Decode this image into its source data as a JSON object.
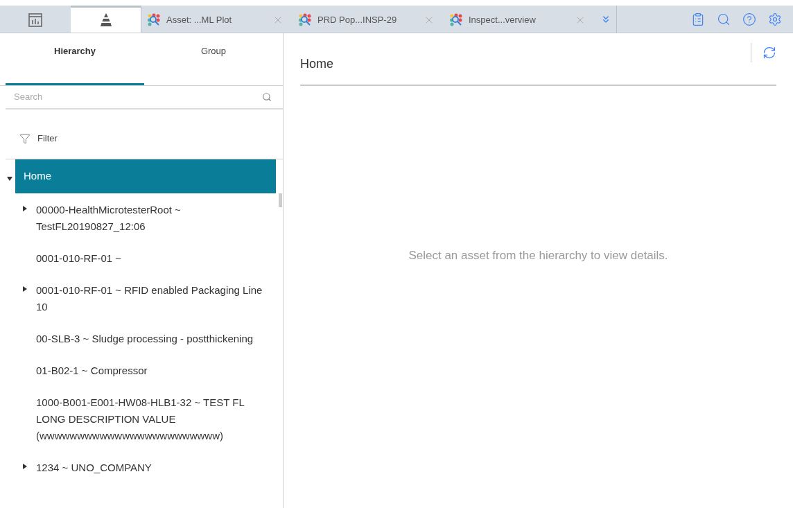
{
  "app_tabs": [
    {
      "kind": "dashboard",
      "selected": false
    },
    {
      "kind": "hierarchy",
      "selected": true
    },
    {
      "kind": "document",
      "label": "Asset: ...ML Plot",
      "selected": false
    },
    {
      "kind": "document",
      "label": "PRD Pop...INSP-29",
      "selected": false
    },
    {
      "kind": "document",
      "label": "Inspect...verview",
      "selected": false
    }
  ],
  "side_tabs": [
    {
      "label": "Hierarchy",
      "selected": true
    },
    {
      "label": "Group",
      "selected": false
    }
  ],
  "search": {
    "placeholder": "Search"
  },
  "filter": {
    "label": "Filter"
  },
  "tree": [
    {
      "label": "Home",
      "kind": "branch",
      "expanded": true,
      "selected": true,
      "children": [
        {
          "label": "00000-HealthMicrotesterRoot ~ TestFL20190827_12:06",
          "kind": "branch",
          "expanded": false,
          "selected": false
        },
        {
          "label": "0001-010-RF-01 ~",
          "kind": "leaf",
          "selected": false
        },
        {
          "label": "0001-010-RF-01 ~ RFID enabled Packaging Line 10",
          "kind": "branch",
          "expanded": false,
          "selected": false
        },
        {
          "label": "00-SLB-3 ~ Sludge processing - postthickening",
          "kind": "leaf",
          "selected": false
        },
        {
          "label": "01-B02-1 ~ Compressor",
          "kind": "leaf",
          "selected": false
        },
        {
          "label": "1000-B001-E001-HW08-HLB1-32 ~ TEST FL LONG DESCRIPTION VALUE (wwwwwwwwwwwwwwwwwwwwwwww)",
          "kind": "leaf",
          "selected": false
        },
        {
          "label": "1234 ~ UNO_COMPANY",
          "kind": "branch",
          "expanded": false,
          "selected": false
        }
      ]
    }
  ],
  "details": {
    "title": "Home",
    "message": "Select an asset from the hierarchy to view details."
  }
}
